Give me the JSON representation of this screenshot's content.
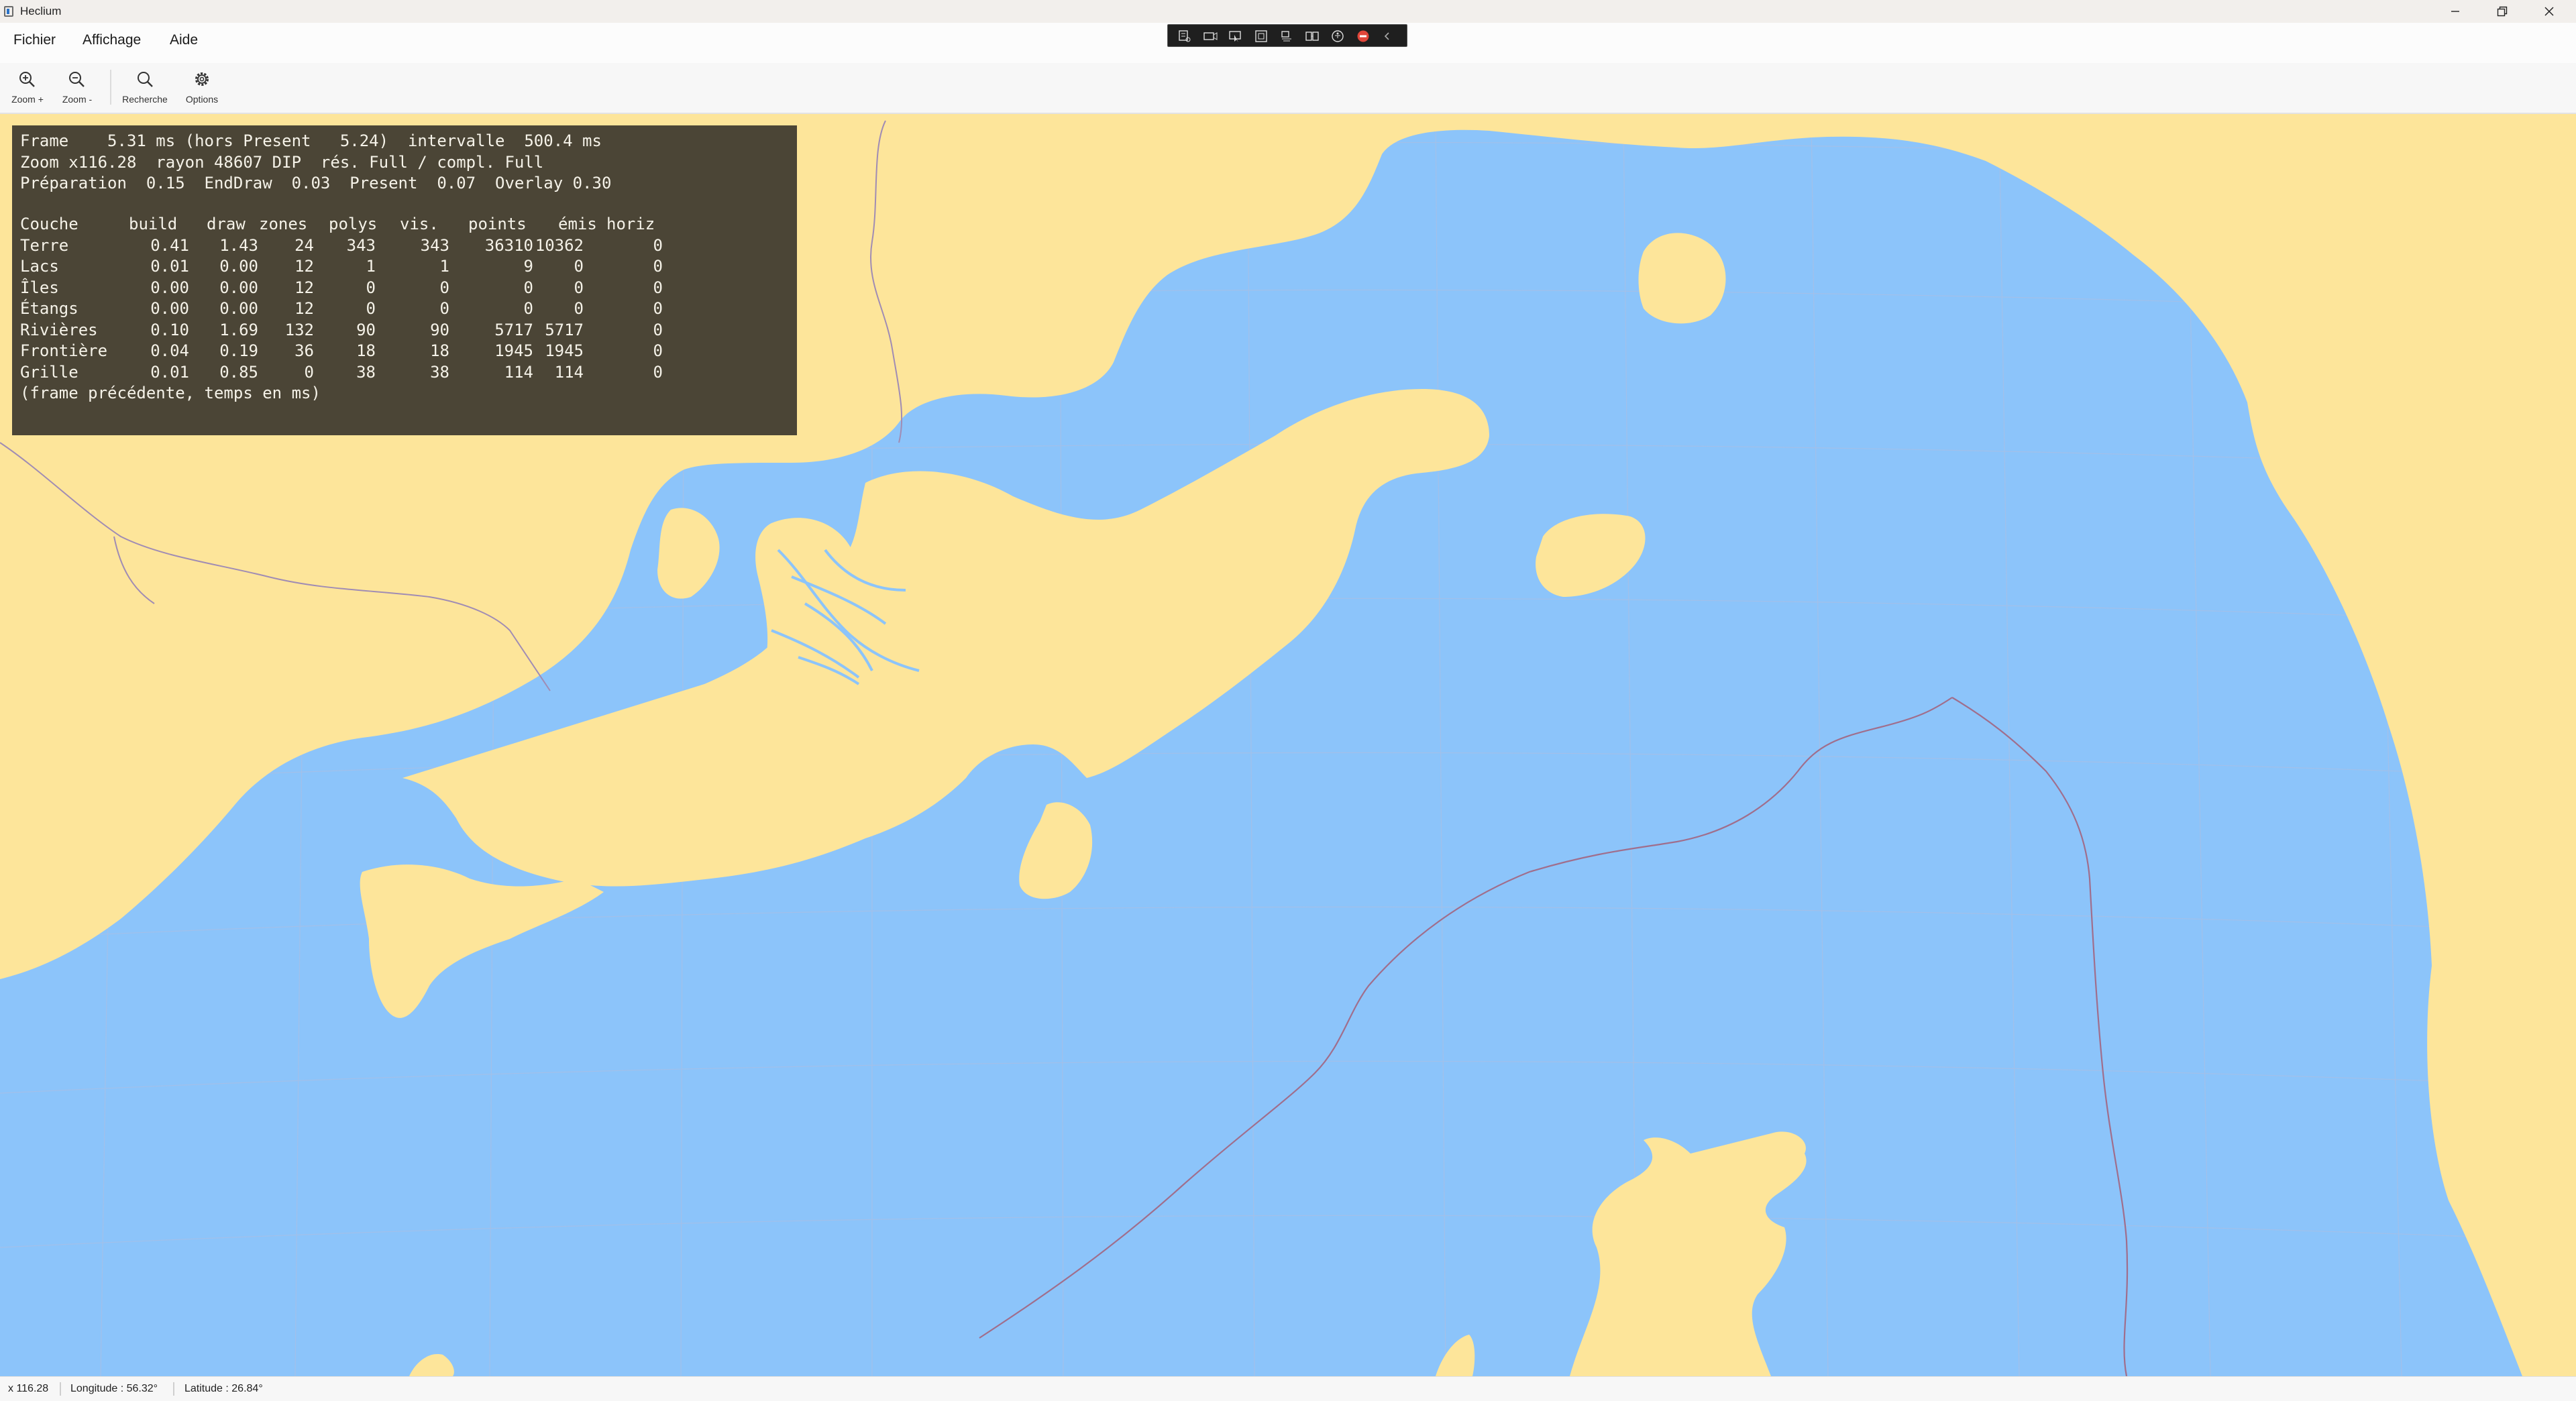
{
  "window": {
    "title": "Heclium",
    "controls": [
      "minimize-icon",
      "restore-icon",
      "close-icon"
    ]
  },
  "menu": {
    "items": [
      {
        "label": "Fichier"
      },
      {
        "label": "Affichage"
      },
      {
        "label": "Aide"
      }
    ]
  },
  "toolbar": {
    "zoom_in": {
      "label": "Zoom +",
      "icon": "zoom-in-icon"
    },
    "zoom_out": {
      "label": "Zoom -",
      "icon": "zoom-out-icon"
    },
    "search": {
      "label": "Recherche",
      "icon": "search-icon"
    },
    "options": {
      "label": "Options",
      "icon": "gear-icon"
    }
  },
  "floating_toolbar": {
    "icons": [
      "live-tree-icon",
      "camera-icon",
      "select-element-icon",
      "display-layout-adorners-icon",
      "track-focus-icon",
      "binding-failures-icon",
      "accessibility-icon",
      "stop-icon",
      "collapse-icon"
    ]
  },
  "stats": {
    "line1": "Frame    5.31 ms (hors Present   5.24)  intervalle  500.4 ms",
    "line2": "Zoom x116.28  rayon 48607 DIP  rés. Full / compl. Full",
    "line3": "Préparation  0.15  EndDraw  0.03  Present  0.07  Overlay 0.30",
    "headers": [
      "Couche",
      "build",
      "draw",
      "zones",
      "polys",
      "vis.",
      "points",
      "émis",
      "horiz"
    ],
    "rows": [
      [
        "Terre",
        "0.41",
        "1.43",
        "24",
        "343",
        "343",
        "36310",
        "10362",
        "0"
      ],
      [
        "Lacs",
        "0.01",
        "0.00",
        "12",
        "1",
        "1",
        "9",
        "0",
        "0"
      ],
      [
        "Îles",
        "0.00",
        "0.00",
        "12",
        "0",
        "0",
        "0",
        "0",
        "0"
      ],
      [
        "Étangs",
        "0.00",
        "0.00",
        "12",
        "0",
        "0",
        "0",
        "0",
        "0"
      ],
      [
        "Rivières",
        "0.10",
        "1.69",
        "132",
        "90",
        "90",
        "5717",
        "5717",
        "0"
      ],
      [
        "Frontière",
        "0.04",
        "0.19",
        "36",
        "18",
        "18",
        "1945",
        "1945",
        "0"
      ],
      [
        "Grille",
        "0.01",
        "0.85",
        "0",
        "38",
        "38",
        "114",
        "114",
        "0"
      ]
    ],
    "footnote": "(frame précédente, temps en ms)"
  },
  "map": {
    "water_color": "#8cc4fa",
    "land_color": "#fde59a",
    "border_color": "#a08cb4",
    "grid_color": "#b4bedc"
  },
  "status": {
    "zoom": "x 116.28",
    "longitude": "Longitude : 56.32°",
    "latitude": "Latitude : 26.84°"
  }
}
